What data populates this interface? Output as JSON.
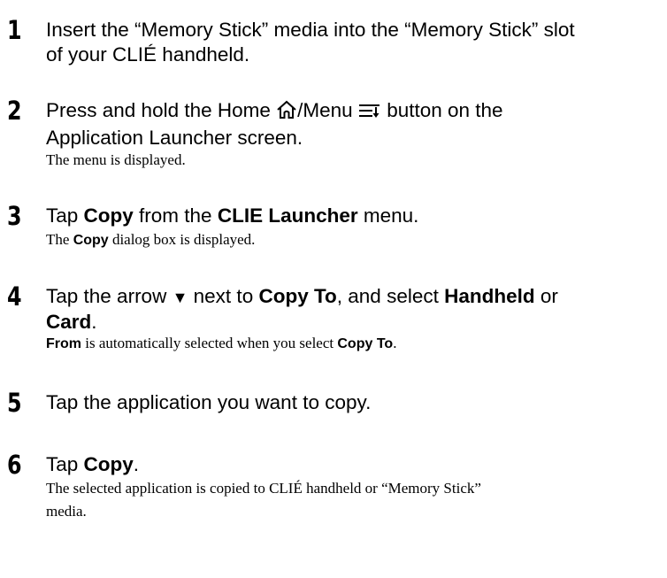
{
  "steps": [
    {
      "number": "1",
      "instruction": {
        "line1": "Insert the “Memory Stick” media into the “Memory Stick” slot",
        "line2": "of your CLIÉ handheld."
      }
    },
    {
      "number": "2",
      "instruction": {
        "part1": "Press and hold the Home ",
        "part2": "/Menu ",
        "part3": " button on the",
        "line2": "Application Launcher screen."
      },
      "icons": [
        "home-icon",
        "menu-icon"
      ],
      "note": "The menu is displayed."
    },
    {
      "number": "3",
      "instruction": {
        "part1": "Tap ",
        "bold1": "Copy",
        "part2": " from the ",
        "bold2": "CLIE Launcher",
        "part3": " menu."
      },
      "note": {
        "part1": "The ",
        "bold1": "Copy",
        "part2": " dialog box is displayed."
      }
    },
    {
      "number": "4",
      "instruction": {
        "part1": "Tap the arrow ",
        "arrow": "▼",
        "part2": " next to ",
        "bold1": "Copy To",
        "part3": ", and select ",
        "bold2": "Handheld",
        "part4": " or",
        "bold3": "Card",
        "part5": "."
      },
      "note": {
        "bold1": "From",
        "part1": " is automatically selected when you select ",
        "bold2": "Copy To",
        "part2": "."
      }
    },
    {
      "number": "5",
      "instruction": {
        "text": "Tap the application you want to copy."
      }
    },
    {
      "number": "6",
      "instruction": {
        "part1": "Tap ",
        "bold1": "Copy",
        "part2": "."
      },
      "note": {
        "line1": "The selected application is copied to CLIÉ handheld or “Memory Stick”",
        "line2": "media."
      }
    }
  ]
}
